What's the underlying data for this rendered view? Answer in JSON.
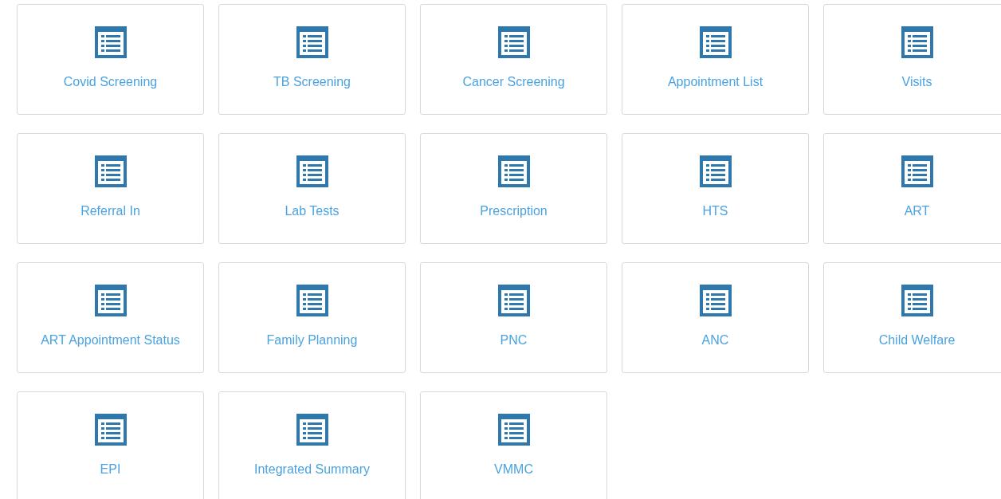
{
  "tiles": [
    {
      "label": "Covid Screening"
    },
    {
      "label": "TB Screening"
    },
    {
      "label": "Cancer Screening"
    },
    {
      "label": "Appointment List"
    },
    {
      "label": "Visits"
    },
    {
      "label": "Referral In"
    },
    {
      "label": "Lab Tests"
    },
    {
      "label": "Prescription"
    },
    {
      "label": "HTS"
    },
    {
      "label": "ART"
    },
    {
      "label": "ART Appointment Status"
    },
    {
      "label": "Family Planning"
    },
    {
      "label": "PNC"
    },
    {
      "label": "ANC"
    },
    {
      "label": "Child Welfare"
    },
    {
      "label": "EPI"
    },
    {
      "label": "Integrated Summary"
    },
    {
      "label": "VMMC"
    }
  ]
}
